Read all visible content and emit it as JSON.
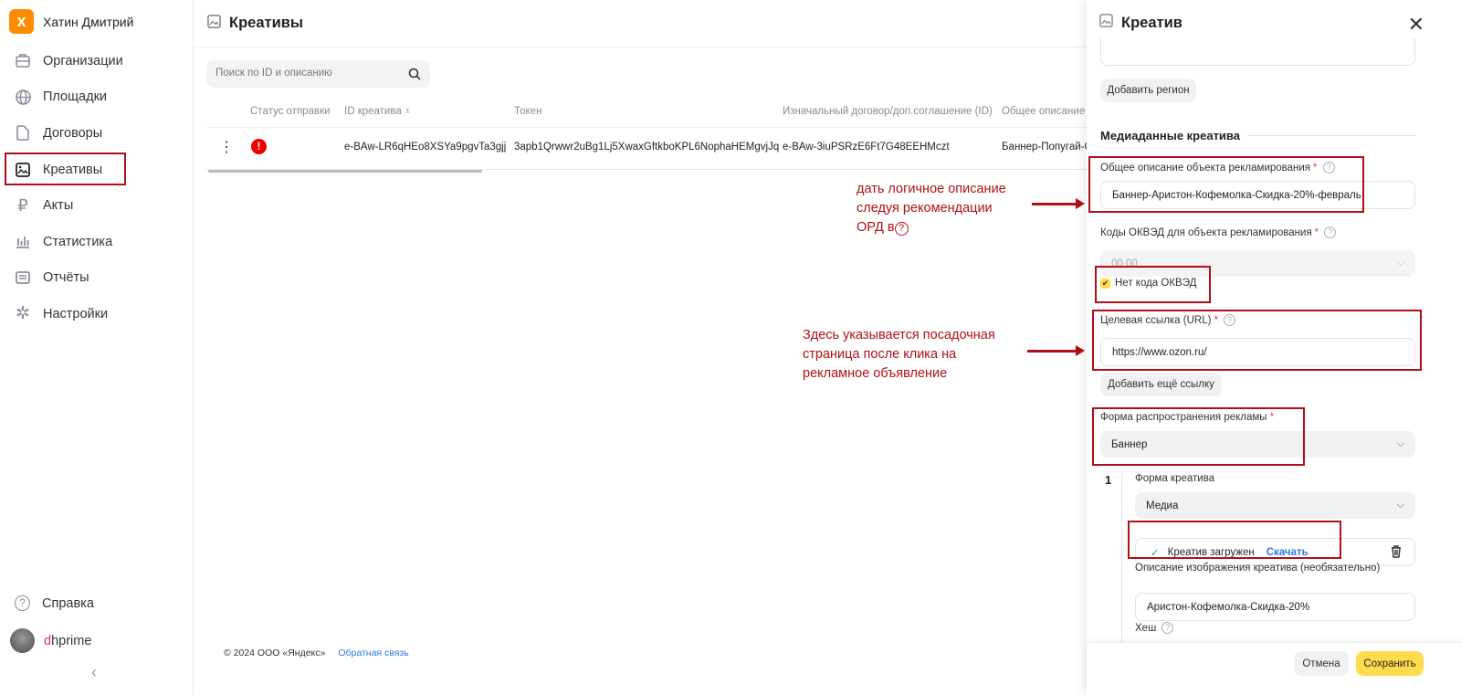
{
  "sidebar": {
    "org_name": "Хатин Дмитрий",
    "logo_letter": "x",
    "items": [
      {
        "label": "Организации",
        "icon": "briefcase-icon"
      },
      {
        "label": "Площадки",
        "icon": "globe-icon"
      },
      {
        "label": "Договоры",
        "icon": "document-icon"
      },
      {
        "label": "Креативы",
        "icon": "image-icon"
      },
      {
        "label": "Акты",
        "icon": "ruble-icon"
      },
      {
        "label": "Статистика",
        "icon": "bar-chart-icon"
      },
      {
        "label": "Отчёты",
        "icon": "report-icon"
      },
      {
        "label": "Настройки",
        "icon": "gear-icon"
      }
    ],
    "help": "Справка",
    "user_first": "d",
    "user_rest": "hprime",
    "active": "Креативы"
  },
  "main": {
    "title": "Креативы",
    "search_placeholder": "Поиск по ID и описанию",
    "columns": [
      "Статус отправки",
      "ID креатива",
      "Токен",
      "Изначальный договор/доп.соглашение (ID)",
      "Общее описание о"
    ],
    "sort_icon": "⩡",
    "rows": [
      {
        "id": "e-BAw-LR6qHEo8XSYa9pgvTa3gjj",
        "token": "3apb1Qrwwr2uBg1Lj5XwaxGftkboKPL6NophaHEMgvjJq",
        "contract": "e-BAw-3iuPSRzE6Ft7G48EEHMczt",
        "description": "Баннер-Попугай-Ск",
        "status": "error"
      }
    ],
    "footer_copy": "© 2024 ООО «Яндекс»",
    "footer_link": "Обратная связь"
  },
  "panel": {
    "title": "Креатив",
    "add_region": "Добавить регион",
    "section": "Медиаданные креатива",
    "desc_label": "Общее описание объекта рекламирования",
    "desc_value": "Баннер-Аристон-Кофемолка-Скидка-20%-февраль",
    "okved_label": "Коды ОКВЭД для объекта рекламирования",
    "okved_value": "00.00",
    "no_okved": "Нет кода ОКВЭД",
    "url_label": "Целевая ссылка (URL)",
    "url_value": "https://www.ozon.ru/",
    "add_link": "Добавить ещё ссылку",
    "form_label": "Форма распространения рекламы",
    "form_value": "Баннер",
    "item_number": "1",
    "creative_form_label": "Форма креатива",
    "creative_form_value": "Медиа",
    "uploaded": "Креатив загружен",
    "download": "Скачать",
    "img_desc_label": "Описание изображения креатива (необязательно)",
    "img_desc_value": "Аристон-Кофемолка-Скидка-20%",
    "hash_label": "Хеш",
    "cancel": "Отмена",
    "save": "Сохранить",
    "required_mark": "*",
    "help_mark": "?"
  },
  "annotations": {
    "note1": [
      "дать логичное описание",
      "следуя рекомендации",
      "ОРД в"
    ],
    "note2": [
      "Здесь указывается посадочная",
      "страница после клика на",
      "рекламное объявление"
    ]
  },
  "colors": {
    "accent": "#ffdb4d",
    "annotation": "#b10f16",
    "link": "#2c7be5",
    "logo": "#fc8c00"
  }
}
